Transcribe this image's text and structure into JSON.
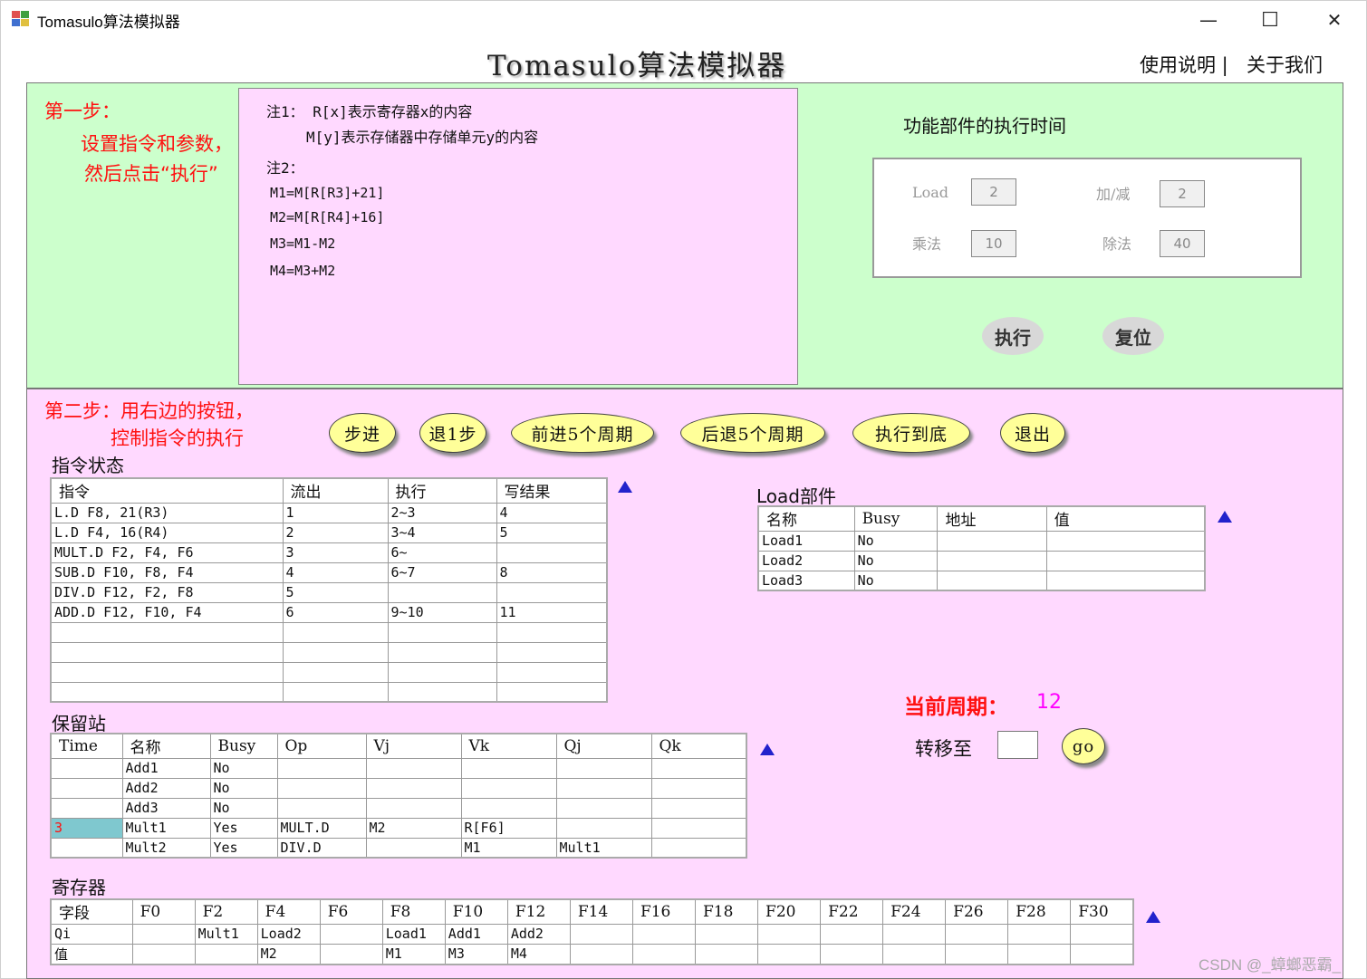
{
  "window": {
    "title": "Tomasulo算法模拟器",
    "minimize": "—",
    "maximize": "☐",
    "close": "✕"
  },
  "header": {
    "title": "Tomasulo算法模拟器",
    "help_link": "使用说明 |",
    "about_link": "关于我们"
  },
  "step1": {
    "line1": "第一步：",
    "line2": "设置指令和参数，",
    "line3": "然后点击“执行”",
    "notes": {
      "n1a": "注1：  R[x]表示寄存器x的内容",
      "n1b": "M[y]表示存储器中存储单元y的内容",
      "n2": "注2：",
      "m1": "M1=M[R[R3]+21]",
      "m2": "M2=M[R[R4]+16]",
      "m3": "M3=M1-M2",
      "m4": "M4=M3+M2"
    },
    "fu_title": "功能部件的执行时间",
    "fu": {
      "load_label": "Load",
      "load_value": "2",
      "addsub_label": "加/减",
      "addsub_value": "2",
      "mul_label": "乘法",
      "mul_value": "10",
      "div_label": "除法",
      "div_value": "40"
    },
    "execute": "执行",
    "reset": "复位"
  },
  "step2": {
    "line1": "第二步：用右边的按钮，",
    "line2": "控制指令的执行",
    "buttons": {
      "step": "步进",
      "back1": "退1步",
      "fwd5": "前进5个周期",
      "back5": "后退5个周期",
      "run_end": "执行到底",
      "exit": "退出"
    }
  },
  "instr": {
    "label": "指令状态",
    "headers": [
      "指令",
      "流出",
      "执行",
      "写结果"
    ],
    "rows": [
      [
        "L.D     F8, 21(R3)",
        "1",
        "2~3",
        "4"
      ],
      [
        "L.D     F4, 16(R4)",
        "2",
        "3~4",
        "5"
      ],
      [
        "MULT.D  F2, F4, F6",
        "3",
        "6~",
        ""
      ],
      [
        "SUB.D   F10, F8, F4",
        "4",
        "6~7",
        "8"
      ],
      [
        "DIV.D   F12, F2, F8",
        "5",
        "",
        ""
      ],
      [
        "ADD.D   F12, F10, F4",
        "6",
        "9~10",
        "11"
      ],
      [
        "",
        "",
        "",
        ""
      ],
      [
        "",
        "",
        "",
        ""
      ],
      [
        "",
        "",
        "",
        ""
      ],
      [
        "",
        "",
        "",
        ""
      ]
    ]
  },
  "load": {
    "label": "Load部件",
    "headers": [
      "名称",
      "Busy",
      "地址",
      "值"
    ],
    "rows": [
      [
        "Load1",
        "No",
        "",
        ""
      ],
      [
        "Load2",
        "No",
        "",
        ""
      ],
      [
        "Load3",
        "No",
        "",
        ""
      ]
    ]
  },
  "rs": {
    "label": "保留站",
    "headers": [
      "Time",
      "名称",
      "Busy",
      "Op",
      "Vj",
      "Vk",
      "Qj",
      "Qk"
    ],
    "rows": [
      [
        "",
        "Add1",
        "No",
        "",
        "",
        "",
        "",
        ""
      ],
      [
        "",
        "Add2",
        "No",
        "",
        "",
        "",
        "",
        ""
      ],
      [
        "",
        "Add3",
        "No",
        "",
        "",
        "",
        "",
        ""
      ],
      [
        "3",
        "Mult1",
        "Yes",
        "MULT.D",
        "M2",
        "R[F6]",
        "",
        ""
      ],
      [
        "",
        "Mult2",
        "Yes",
        "DIV.D",
        "",
        "M1",
        "Mult1",
        ""
      ]
    ],
    "highlight_color": "#7fc8cf"
  },
  "cycle": {
    "label": "当前周期：",
    "value": "12",
    "goto_label": "转移至",
    "goto_value": "",
    "go": "go"
  },
  "reg": {
    "label": "寄存器",
    "headers": [
      "字段",
      "F0",
      "F2",
      "F4",
      "F6",
      "F8",
      "F10",
      "F12",
      "F14",
      "F16",
      "F18",
      "F20",
      "F22",
      "F24",
      "F26",
      "F28",
      "F30"
    ],
    "rows": [
      [
        "Qi",
        "",
        "Mult1",
        "Load2",
        "",
        "Load1",
        "Add1",
        "Add2",
        "",
        "",
        "",
        "",
        "",
        "",
        "",
        "",
        ""
      ],
      [
        "值",
        "",
        "",
        "M2",
        "",
        "M1",
        "M3",
        "M4",
        "",
        "",
        "",
        "",
        "",
        "",
        "",
        "",
        ""
      ]
    ]
  },
  "watermark": "CSDN @_蟑螂恶霸_",
  "colors": {
    "step1_bg": "#ccffcc",
    "step2_bg": "#ffd9ff",
    "accent_red": "#ff1010",
    "cycle_value": "#ff00ff",
    "sort_arrow": "#2222cc"
  }
}
